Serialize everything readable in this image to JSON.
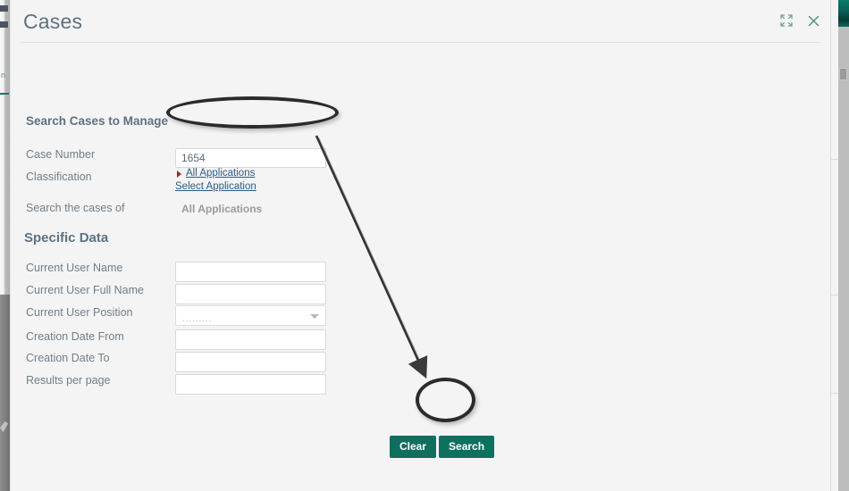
{
  "window": {
    "title": "Cases",
    "icons": [
      {
        "name": "expand-icon",
        "label": "Expand"
      },
      {
        "name": "close-icon",
        "label": "Close"
      }
    ]
  },
  "sections": {
    "search_cases": {
      "heading": "Search Cases to Manage",
      "fields": [
        {
          "label": "Case Number",
          "type": "text",
          "value": "1654",
          "placeholder": ""
        },
        {
          "label": "Classification",
          "type": "links"
        },
        {
          "label": "Search the cases of",
          "type": "static",
          "value": "All Applications"
        }
      ],
      "classification_links": [
        {
          "text": "All Applications",
          "bulleted": true
        },
        {
          "text": "Select Application",
          "bulleted": false
        }
      ]
    },
    "specific_data": {
      "heading": "Specific Data",
      "fields": [
        {
          "label": "Current User Name",
          "type": "text",
          "value": "",
          "placeholder": ""
        },
        {
          "label": "Current User Full Name",
          "type": "text",
          "value": "",
          "placeholder": ""
        },
        {
          "label": "Current User Position",
          "type": "select",
          "value": "",
          "placeholder": "........."
        },
        {
          "label": "Creation Date From",
          "type": "text",
          "value": "",
          "placeholder": ""
        },
        {
          "label": "Creation Date To",
          "type": "text",
          "value": "",
          "placeholder": ""
        },
        {
          "label": "Results per page",
          "type": "text",
          "value": "",
          "placeholder": ""
        }
      ]
    }
  },
  "buttons": {
    "clear": "Clear",
    "search": "Search"
  },
  "colors": {
    "panel_bg": "#f4f4f4",
    "title_text": "#5d7183",
    "label_text": "#707e89",
    "link_text": "#2f5c84",
    "button_bg": "#0e6f5e",
    "accent_teal": "#0c7a68",
    "annotation": "#2b2b2b",
    "bullet_red": "#9b2d2d"
  },
  "annotations": {
    "highlight_case_number": "oval around Case Number input",
    "highlight_search": "oval around Search button",
    "arrow": "arrow from Case Number field to Search button"
  }
}
